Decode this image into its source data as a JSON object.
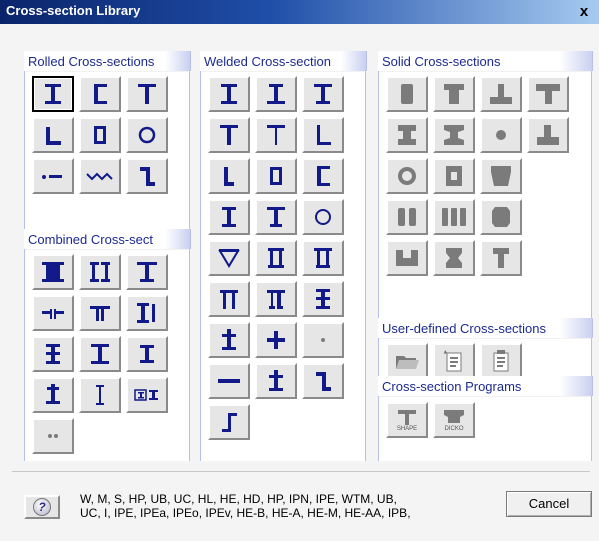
{
  "window": {
    "title": "Cross-section Library",
    "close_label": "x"
  },
  "panels": {
    "rolled": {
      "title": "Rolled Cross-sections"
    },
    "combined": {
      "title": "Combined Cross-sect"
    },
    "welded": {
      "title": "Welded Cross-section"
    },
    "solid": {
      "title": "Solid Cross-sections"
    },
    "user_defined": {
      "title": "User-defined Cross-sections"
    },
    "programs": {
      "title": "Cross-section Programs",
      "items": [
        {
          "name": "shape-program-button",
          "label": "SHAPE"
        },
        {
          "name": "dicko-program-button",
          "label": "DICKO"
        }
      ]
    }
  },
  "footer": {
    "description_line1": "W, M, S, HP, UB, UC, HL, HE, HD, HP, IPN, IPE, WTM, UB,",
    "description_line2": "UC, I, IPE, IPEa, IPEo, IPEv, HE-B, HE-A, HE-M, HE-AA, IPB,",
    "help_icon": "?",
    "cancel_label": "Cancel"
  },
  "colors": {
    "accent": "#111a88",
    "header_text": "#1c2a90",
    "disabled": "#7b7b7b"
  }
}
